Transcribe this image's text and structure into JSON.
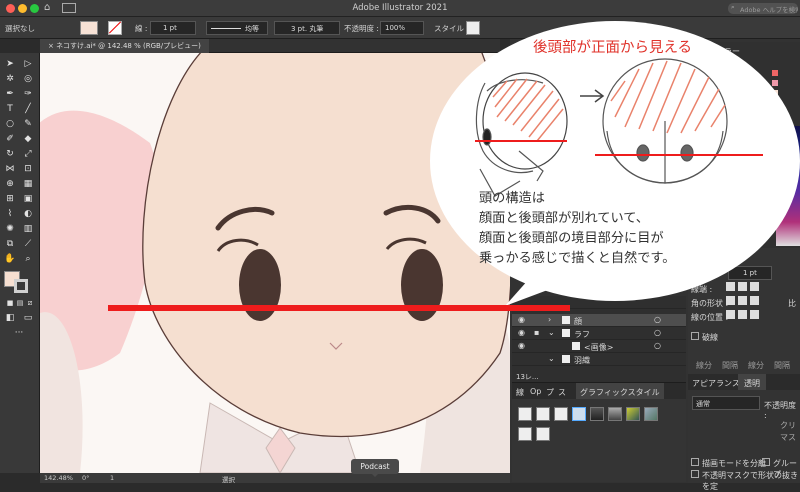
{
  "app": {
    "title": "Adobe Illustrator 2021",
    "help_search_placeholder": "Adobe ヘルプを検索"
  },
  "control": {
    "selection": "選択なし",
    "stroke_label": "線 :",
    "stroke_width": "1 pt",
    "stroke_profile": "均等",
    "brush": "3 pt. 丸筆",
    "opacity_label": "不透明度 :",
    "opacity": "100%",
    "style_label": "スタイル :"
  },
  "document": {
    "tab_label": "ネコすけ.ai* @ 142.48 % (RGB/プレビュー)",
    "close_icon": "×"
  },
  "status": {
    "zoom": "142.48%",
    "angle": "0°",
    "page": "1",
    "tool": "選択"
  },
  "tooltip": {
    "label": "Podcast"
  },
  "layers": {
    "rows": [
      {
        "name": "",
        "selected": false
      },
      {
        "name": "顔",
        "selected": true
      },
      {
        "name": "ラフ",
        "selected": false
      },
      {
        "name": "<画像>",
        "selected": false
      },
      {
        "name": "羽織",
        "selected": false
      }
    ],
    "footer_count": "13レ..."
  },
  "graphic_styles": {
    "tabs": [
      "線",
      "Op",
      "プ",
      "ス",
      "グラフィックスタイル"
    ]
  },
  "properties": {
    "linecap_label": "線端 :",
    "corner_label": "角の形状 :",
    "align_label": "線の位置 :",
    "dash_label": "破線",
    "dash_fields": [
      "線分",
      "間隔",
      "線分",
      "間隔"
    ],
    "stroke_value": "1 pt",
    "ratio_label": "比"
  },
  "appearance": {
    "tabs": [
      "アピアランス",
      "透明"
    ],
    "blend": "通常",
    "opacity_label": "不透明度 :",
    "clip_label": "クリ",
    "invert_label": "マス",
    "isolate_label": "描画モードを分離",
    "knockout_label": "グループ",
    "opacity_mask_label": "不透明マスクで形状の抜きを定"
  },
  "colorpanel": {
    "tab_label": "カラー"
  },
  "annotation": {
    "title": "後頭部が正面から見える",
    "body": [
      "頭の構造は",
      "顔面と後頭部が別れていて、",
      "顔面と後頭部の境目部分に目が",
      "乗っかる感じで描くと自然です。"
    ]
  },
  "colors": {
    "accent_red": "#ee1c1c",
    "skin": "#f5dfd0",
    "eye": "#4a3630"
  }
}
